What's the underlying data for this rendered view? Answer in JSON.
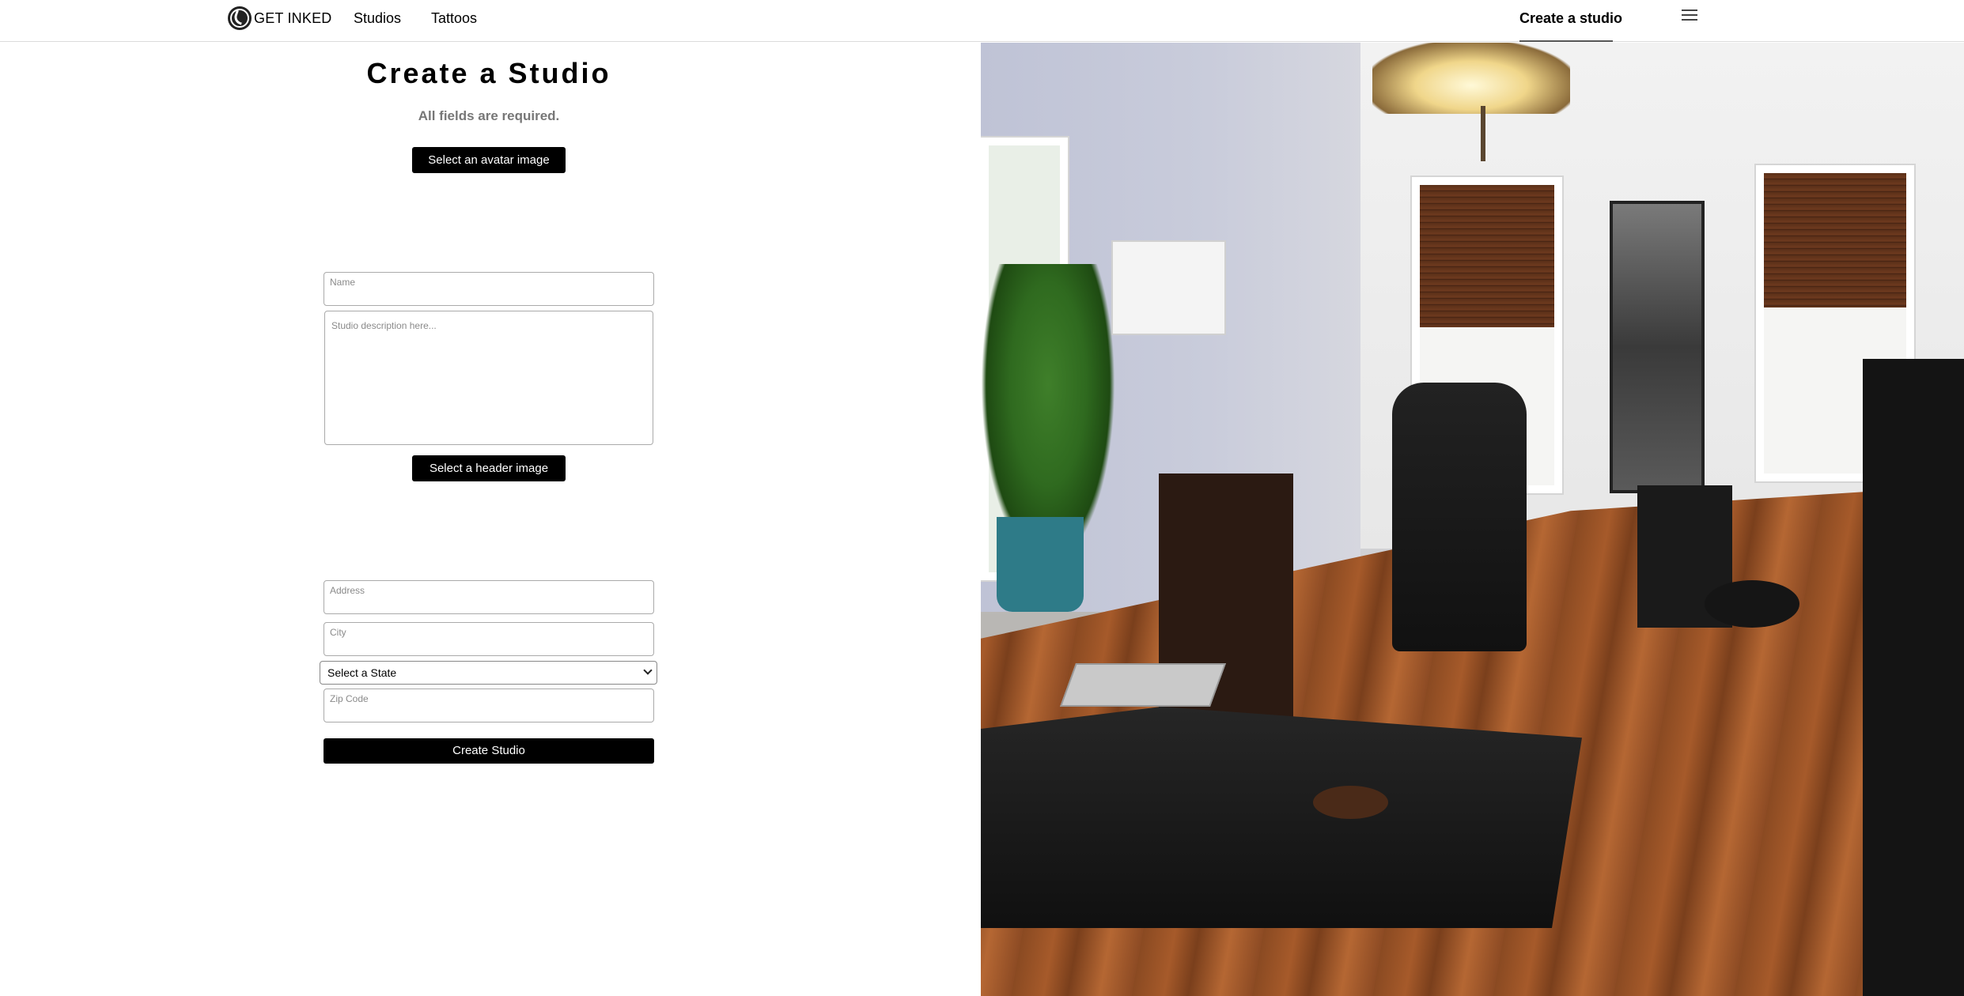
{
  "navbar": {
    "brand": "GET INKED",
    "links": [
      "Studios",
      "Tattoos"
    ],
    "create_link": "Create a studio",
    "menu_icon": "hamburger-menu-icon"
  },
  "form": {
    "title": "Create a Studio",
    "subtitle": "All fields are required.",
    "avatar_button": "Select an avatar image",
    "name_placeholder": "Name",
    "description_placeholder": "Studio description here...",
    "header_button": "Select a header image",
    "address_placeholder": "Address",
    "city_placeholder": "City",
    "state_selected": "Select a State",
    "zip_placeholder": "Zip Code",
    "submit_button": "Create Studio"
  },
  "photo": {
    "icon": "tattoo-studio-photo"
  },
  "colors": {
    "primary": "#000000",
    "muted_text": "#777777",
    "placeholder": "#8a8a8a",
    "border": "#aaaaaa"
  }
}
